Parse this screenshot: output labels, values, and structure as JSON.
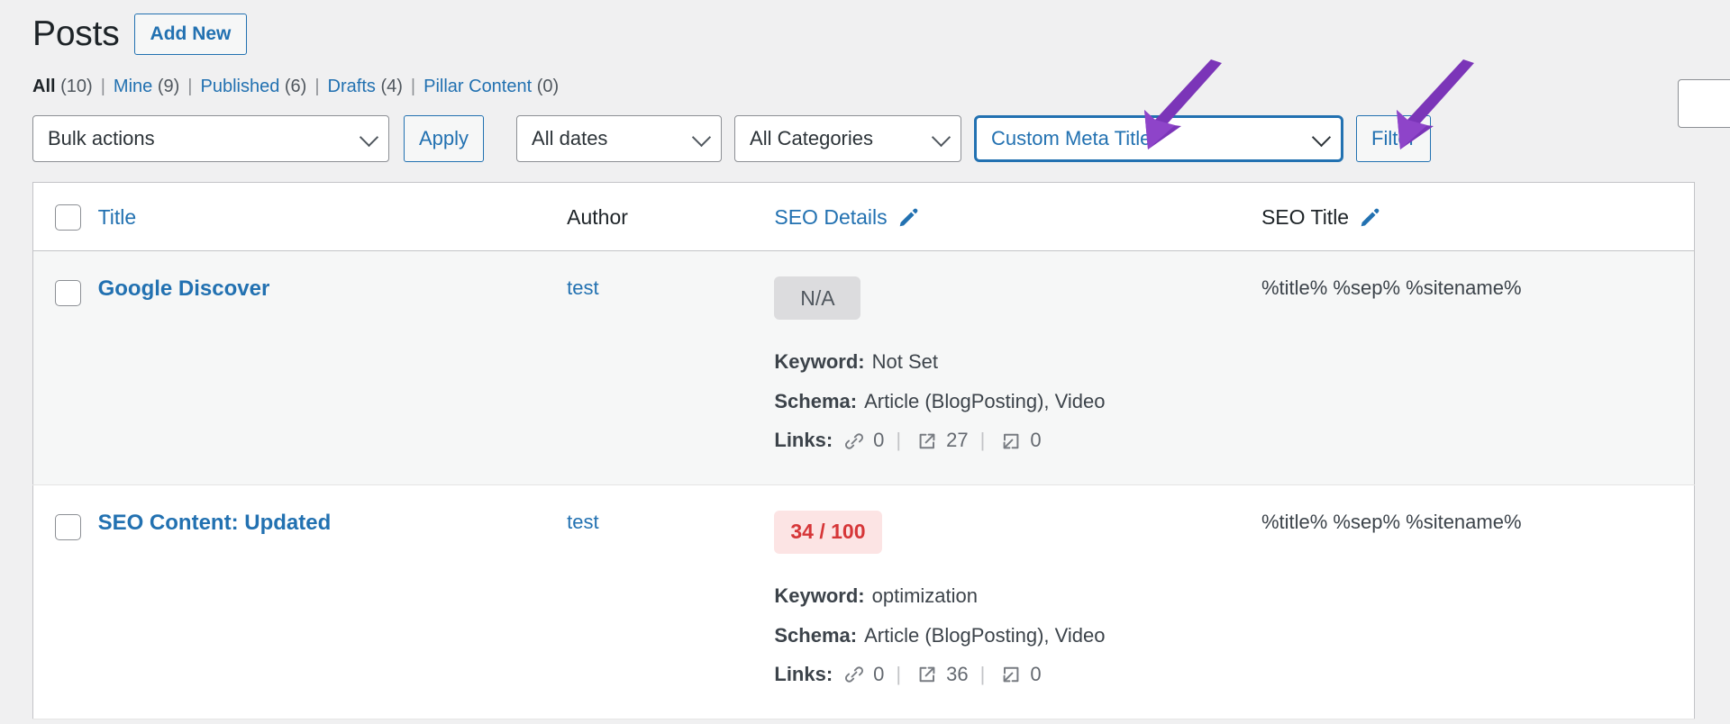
{
  "page": {
    "title": "Posts",
    "add_new_label": "Add New"
  },
  "status_links": [
    {
      "label": "All",
      "count": "(10)",
      "current": true
    },
    {
      "label": "Mine",
      "count": "(9)",
      "current": false
    },
    {
      "label": "Published",
      "count": "(6)",
      "current": false
    },
    {
      "label": "Drafts",
      "count": "(4)",
      "current": false
    },
    {
      "label": "Pillar Content",
      "count": "(0)",
      "current": false
    }
  ],
  "separator": "|",
  "toolbar": {
    "bulk_actions_value": "Bulk actions",
    "apply_label": "Apply",
    "dates_value": "All dates",
    "categories_value": "All Categories",
    "meta_filter_value": "Custom Meta Title",
    "filter_label": "Filter",
    "search_value": ""
  },
  "table": {
    "columns": {
      "title": "Title",
      "author": "Author",
      "seo_details": "SEO Details",
      "seo_title": "SEO Title"
    },
    "rows": [
      {
        "title": "Google Discover",
        "author": "test",
        "score": "N/A",
        "score_type": "na",
        "keyword_label": "Keyword:",
        "keyword_value": "Not Set",
        "schema_label": "Schema:",
        "schema_value": "Article (BlogPosting), Video",
        "links_label": "Links:",
        "links_internal": "0",
        "links_external": "27",
        "links_inbound": "0",
        "seo_title": "%title% %sep% %sitename%"
      },
      {
        "title": "SEO Content: Updated",
        "author": "test",
        "score": "34 / 100",
        "score_type": "bad",
        "keyword_label": "Keyword:",
        "keyword_value": "optimization",
        "schema_label": "Schema:",
        "schema_value": "Article (BlogPosting), Video",
        "links_label": "Links:",
        "links_internal": "0",
        "links_external": "36",
        "links_inbound": "0",
        "seo_title": "%title% %sep% %sitename%"
      }
    ]
  },
  "annotations": {
    "arrow_color": "#7b35b8",
    "arrow_meta_target": "Custom Meta Title",
    "arrow_filter_target": "Filter"
  },
  "colors": {
    "background": "#f0f0f1",
    "link_blue": "#2271b1",
    "highlight_border": "#2271b1",
    "score_bad_text": "#d63638",
    "score_bad_bg": "#fce4e4",
    "score_na_bg": "#dcdcde"
  }
}
